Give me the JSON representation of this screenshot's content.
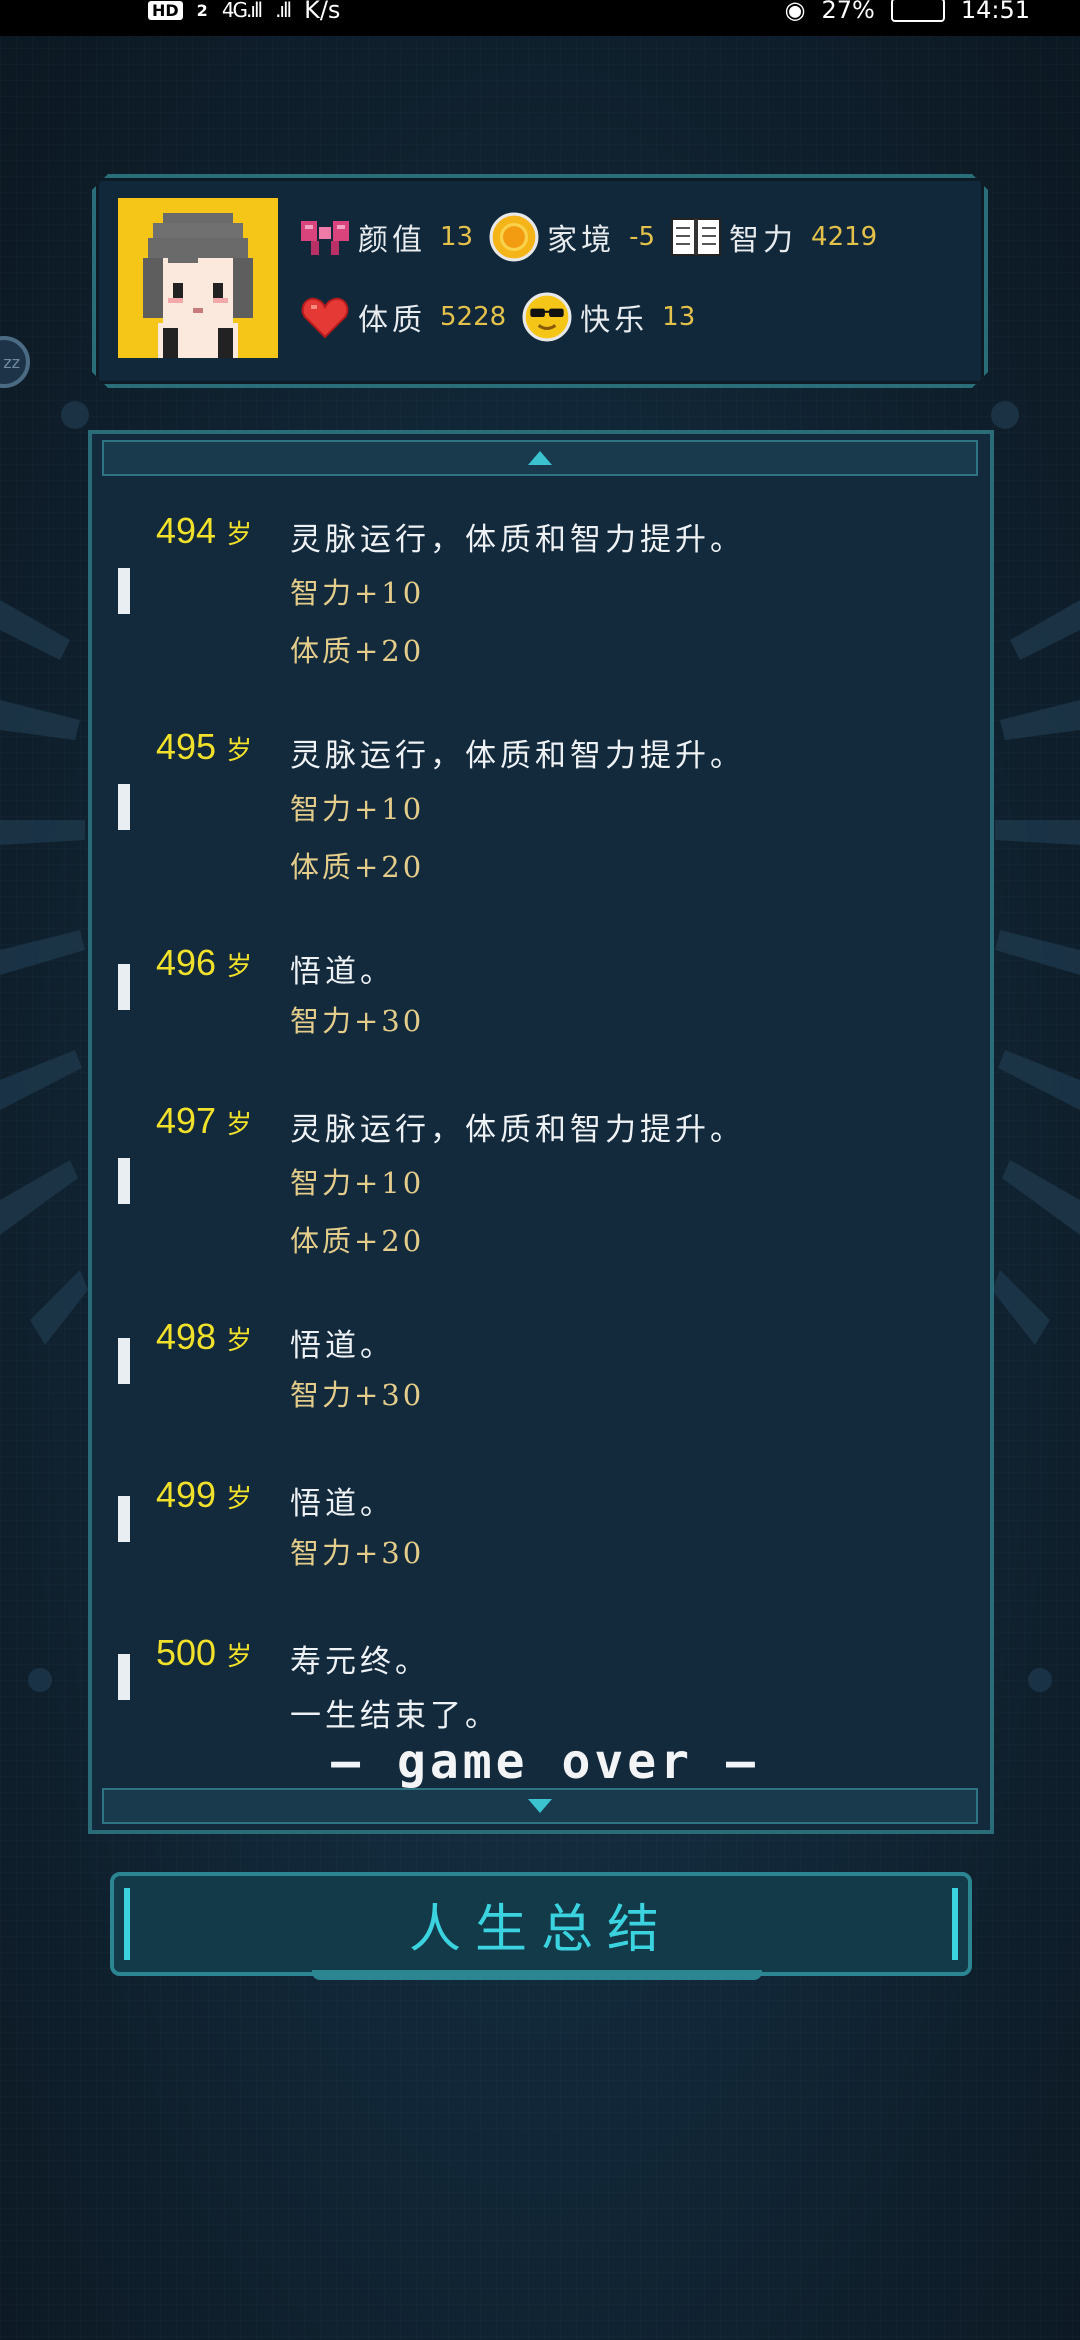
{
  "status_bar": {
    "hd_label": "HD",
    "hd_sim": "2",
    "signal1": "4G.ıll",
    "signal2": ".ıll",
    "speed": "K/s",
    "battery": "27%",
    "time": "14:51"
  },
  "stats": {
    "items": [
      {
        "label": "颜值",
        "value": "13",
        "icon": "bow-icon"
      },
      {
        "label": "家境",
        "value": "-5",
        "icon": "coin-icon"
      },
      {
        "label": "智力",
        "value": "4219",
        "icon": "book-icon"
      },
      {
        "label": "体质",
        "value": "5228",
        "icon": "heart-icon"
      },
      {
        "label": "快乐",
        "value": "13",
        "icon": "sunglasses-face-icon"
      }
    ]
  },
  "log": {
    "entries": [
      {
        "age": "494",
        "unit": "岁",
        "text": "灵脉运行，体质和智力提升。",
        "effects": [
          "智力+10",
          "体质+20"
        ]
      },
      {
        "age": "495",
        "unit": "岁",
        "text": "灵脉运行，体质和智力提升。",
        "effects": [
          "智力+10",
          "体质+20"
        ]
      },
      {
        "age": "496",
        "unit": "岁",
        "text": "悟道。",
        "effects": [
          "智力+30"
        ]
      },
      {
        "age": "497",
        "unit": "岁",
        "text": "灵脉运行，体质和智力提升。",
        "effects": [
          "智力+10",
          "体质+20"
        ]
      },
      {
        "age": "498",
        "unit": "岁",
        "text": "悟道。",
        "effects": [
          "智力+30"
        ]
      },
      {
        "age": "499",
        "unit": "岁",
        "text": "悟道。",
        "effects": [
          "智力+30"
        ]
      },
      {
        "age": "500",
        "unit": "岁",
        "text": "寿元终。",
        "effects": [
          "一生结束了。"
        ]
      }
    ],
    "game_over": "— game over —"
  },
  "summary_button": {
    "label": "人生总结"
  },
  "float_ball": {
    "label": "zz"
  }
}
